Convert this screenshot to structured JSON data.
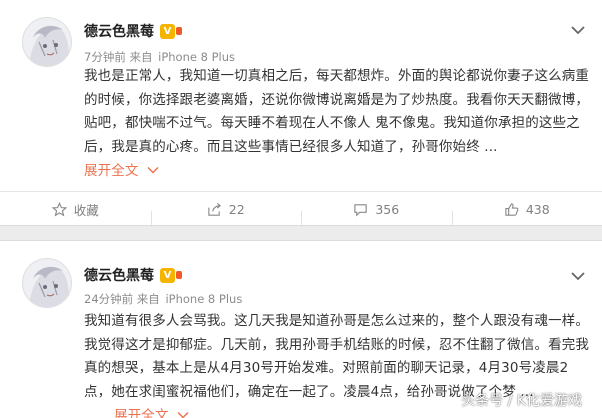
{
  "posts": [
    {
      "author": "德云色黑莓",
      "time": "7分钟前",
      "from": "来自",
      "device": "iPhone 8 Plus",
      "text": "我也是正常人，我知道一切真相之后，每天都想炸。外面的舆论都说你妻子这么病重的时候，你选择跟老婆离婚，还说你微博说离婚是为了炒热度。我看你天天翻微博，贴吧，都快喘不过气。每天睡不着现在人不像人 鬼不像鬼。我知道你承担的这些之后，我是真的心疼。而且这些事情已经很多人知道了，孙哥你始终 ...",
      "expand": "展开全文",
      "actions": {
        "favorite": "收藏",
        "share": "22",
        "comment": "356",
        "like": "438"
      }
    },
    {
      "author": "德云色黑莓",
      "time": "24分钟前",
      "from": "来自",
      "device": "iPhone 8 Plus",
      "text": "我知道有很多人会骂我。这几天我是知道孙哥是怎么过来的，整个人跟没有魂一样。我觉得这才是抑郁症。几天前，我用孙哥手机结账的时候，忍不住翻了微信。看完我真的想哭，基本上是从4月30号开始发难。对照前面的聊天记录，4月30号凌晨2点，她在求闺蜜祝福他们，确定在一起了。凌晨4点，给孙哥说做了个梦 ...",
      "expand": "展开全文"
    }
  ],
  "watermark": "头条号 / K化爱游戏",
  "colors": {
    "accent": "#eb7350",
    "meta_text": "#8c8c8c",
    "vip_badge": "#f4b400"
  },
  "icons": {
    "options": "chevron-down-icon",
    "favorite": "star-outline-icon",
    "share": "share-icon",
    "comment": "comment-icon",
    "like": "thumbs-up-icon",
    "verified": "vip-badge-icon"
  }
}
